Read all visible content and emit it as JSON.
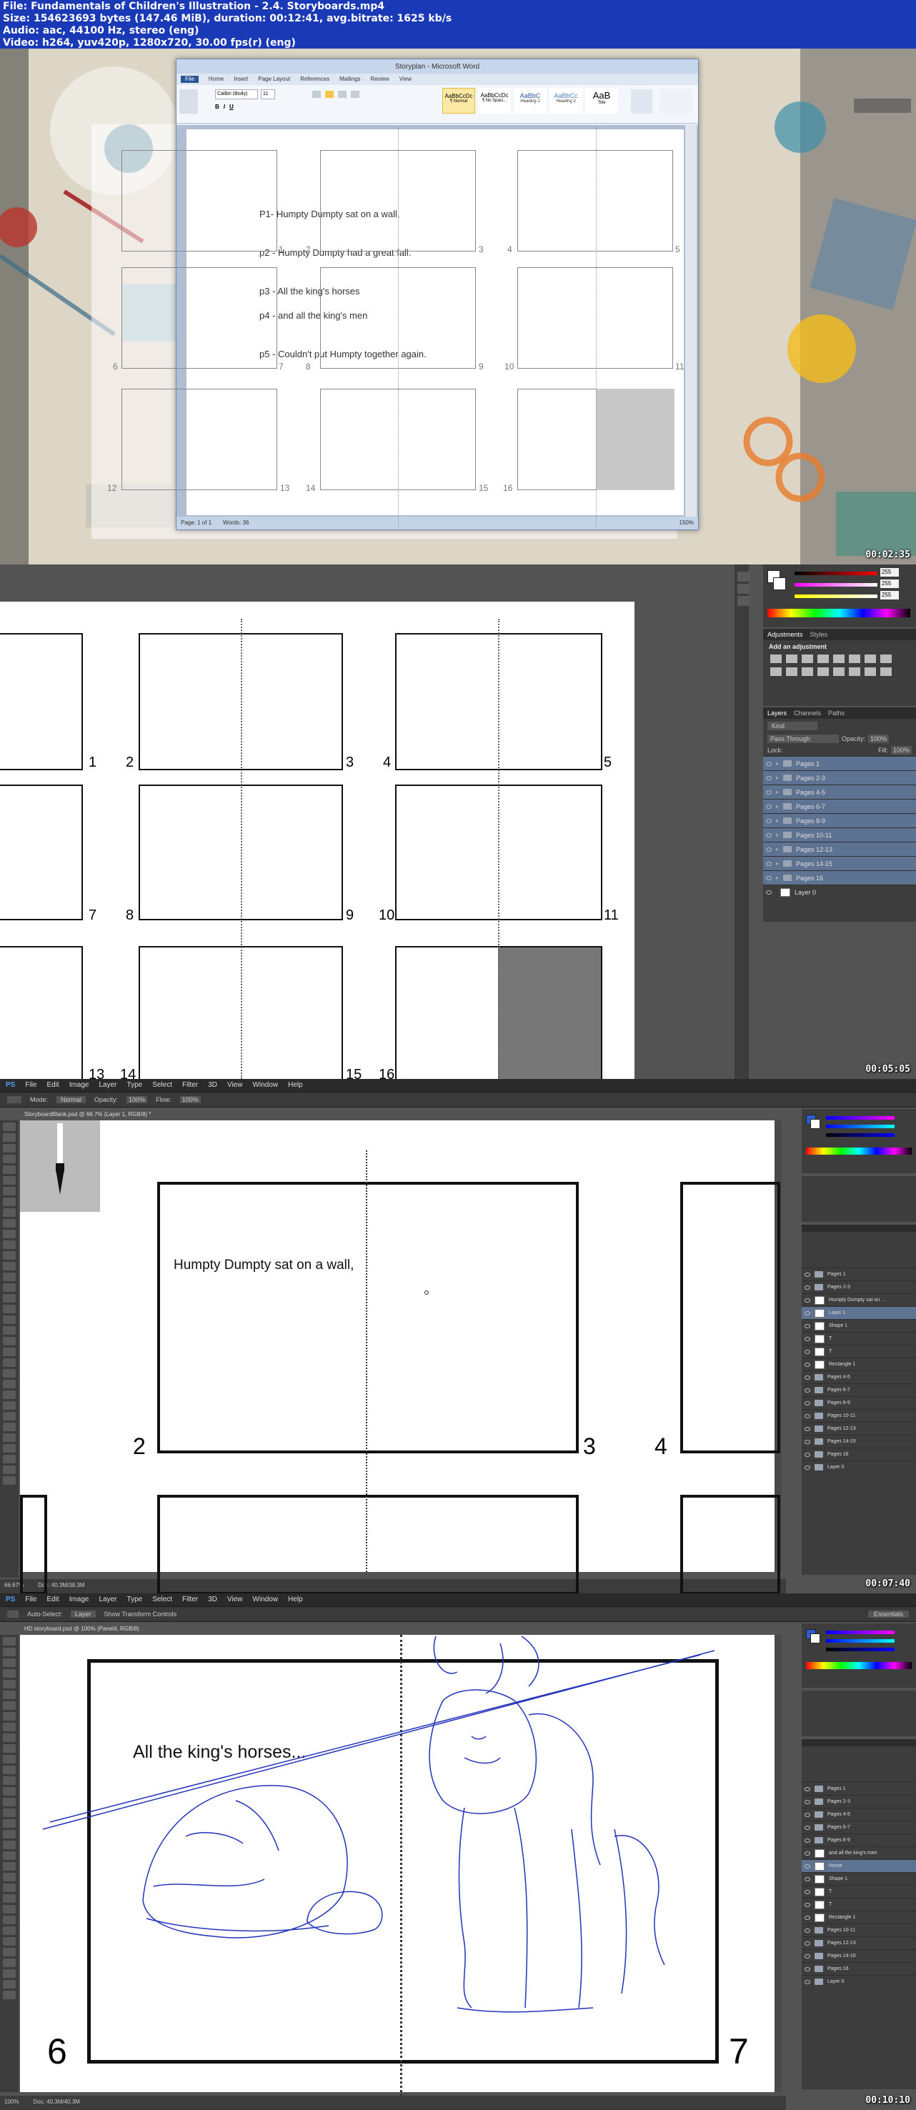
{
  "header": {
    "line1": "File: Fundamentals of Children's Illustration - 2.4. Storyboards.mp4",
    "line2": "Size: 154623693 bytes (147.46 MiB), duration: 00:12:41, avg.bitrate: 1625 kb/s",
    "line3": "Audio: aac, 44100 Hz, stereo (eng)",
    "line4": "Video: h264, yuv420p, 1280x720, 30.00 fps(r) (eng)"
  },
  "frame1": {
    "timestamp": "00:02:35",
    "word_title": "Storyplan - Microsoft Word",
    "ribbon_tabs": [
      "File",
      "Home",
      "Insert",
      "Page Layout",
      "References",
      "Mailings",
      "Review",
      "View"
    ],
    "styles": [
      "AaBbCcDc",
      "AaBbCcDc",
      "AaBbC",
      "AaBbCc",
      "AaB"
    ],
    "style_names": [
      "¶ Normal",
      "¶ No Spaci...",
      "Heading 1",
      "Heading 2",
      "Title"
    ],
    "font_name": "Calibri (Body)",
    "font_size": "11",
    "doc_lines": [
      "P1- Humpty Dumpty sat on a wall,",
      "p2 - Humpty Dumpty had a great fall.",
      "p3 - All the king's horses",
      "p4 - and all the king's men",
      "p5 - Couldn't put Humpty together again."
    ],
    "status": "Page: 1 of 1",
    "words": "Words: 36",
    "zoom": "150%",
    "panel_numbers": [
      "1",
      "2",
      "3",
      "4",
      "5",
      "6",
      "7",
      "8",
      "9",
      "10",
      "11",
      "12",
      "13",
      "14",
      "15",
      "16"
    ]
  },
  "frame2": {
    "timestamp": "00:05:05",
    "numbers": [
      "1",
      "2",
      "3",
      "4",
      "5",
      "7",
      "8",
      "9",
      "10",
      "11",
      "13",
      "14",
      "15",
      "16"
    ],
    "color_values": [
      "255",
      "255",
      "255"
    ],
    "tabs_adjust": [
      "Adjustments",
      "Styles"
    ],
    "add_adjustment": "Add an adjustment",
    "tabs_layers": [
      "Layers",
      "Channels",
      "Paths"
    ],
    "kind": "Kind",
    "blend": "Pass Through",
    "opacity_label": "Opacity:",
    "opacity": "100%",
    "lock_label": "Lock:",
    "fill_label": "Fill:",
    "fill": "100%",
    "layers": [
      "Pages 1",
      "Pages 2-3",
      "Pages 4-5",
      "Pages 6-7",
      "Pages 8-9",
      "Pages 10-11",
      "Pages 12-13",
      "Pages 14-15",
      "Pages 16",
      "Layer 0"
    ]
  },
  "frame3": {
    "timestamp": "00:07:40",
    "menu": [
      "PS",
      "File",
      "Edit",
      "Image",
      "Layer",
      "Type",
      "Select",
      "Filter",
      "3D",
      "View",
      "Window",
      "Help"
    ],
    "doc_tab": "StoryboardBlank.psd @ 66.7% (Layer 1, RGB/8) *",
    "mode_label": "Mode:",
    "mode": "Normal",
    "opacity_label": "Opacity:",
    "opacity": "100%",
    "flow_label": "Flow:",
    "flow": "100%",
    "text": "Humpty Dumpty sat on a wall,",
    "numbers": [
      "2",
      "3",
      "4"
    ],
    "zoom": "66.67%",
    "doc_size": "Doc: 40.3M/38.3M",
    "layers": [
      "Pages 1",
      "Pages 2-3",
      "Humpty Dumpty sat on ...",
      "Layer 1",
      "Shape 1",
      "T",
      "T",
      "Rectangle 1",
      "Pages 4-5",
      "Pages 6-7",
      "Pages 8-9",
      "Pages 10-11",
      "Pages 12-13",
      "Pages 14-15",
      "Pages 16",
      "Layer 0"
    ]
  },
  "frame4": {
    "timestamp": "00:10:10",
    "menu": [
      "PS",
      "File",
      "Edit",
      "Image",
      "Layer",
      "Type",
      "Select",
      "Filter",
      "3D",
      "View",
      "Window",
      "Help"
    ],
    "doc_tab": "HD storyboard.psd @ 100% (Panel4, RGB/8)",
    "auto_select": "Auto-Select:",
    "auto_select_val": "Layer",
    "transform": "Show Transform Controls",
    "essentials": "Essentials",
    "text": "All the king's horses...",
    "numbers": [
      "6",
      "7"
    ],
    "zoom": "100%",
    "doc_size": "Doc: 40.3M/40.3M",
    "layers": [
      "Pages 1",
      "Pages 2-3",
      "Pages 4-5",
      "Pages 6-7",
      "Pages 8-9",
      "and all the king's men",
      "Horse",
      "Shape 1",
      "T",
      "T",
      "Rectangle 1",
      "Pages 10-11",
      "Pages 12-13",
      "Pages 14-15",
      "Pages 16",
      "Layer 0"
    ]
  }
}
